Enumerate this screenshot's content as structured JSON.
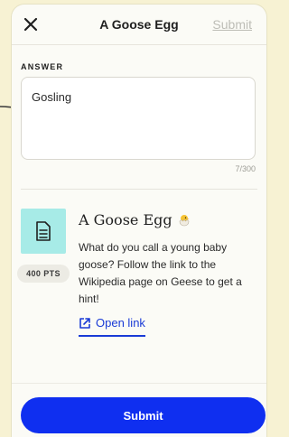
{
  "header": {
    "title": "A Goose Egg",
    "submit_label": "Submit",
    "close_icon": "close-icon"
  },
  "answer": {
    "label": "ANSWER",
    "value": "Gosling",
    "char_count": "7/300"
  },
  "question": {
    "title": "A Goose Egg",
    "title_icon": "hatching-chick-icon",
    "points": "400 PTS",
    "description": "What do you call a young baby goose? Follow the link to the Wikipedia page on Geese to get a hint!",
    "link_label": "Open link",
    "link_icon": "external-link-icon",
    "tile_icon": "document-icon"
  },
  "footer": {
    "submit_label": "Submit"
  },
  "colors": {
    "page_background": "#f7f2d3",
    "card_background": "#fbfbf6",
    "tile": "#a7ebe7",
    "accent": "#0f2ff0",
    "link": "#1a3bd6",
    "disabled": "#bdbdb6"
  }
}
